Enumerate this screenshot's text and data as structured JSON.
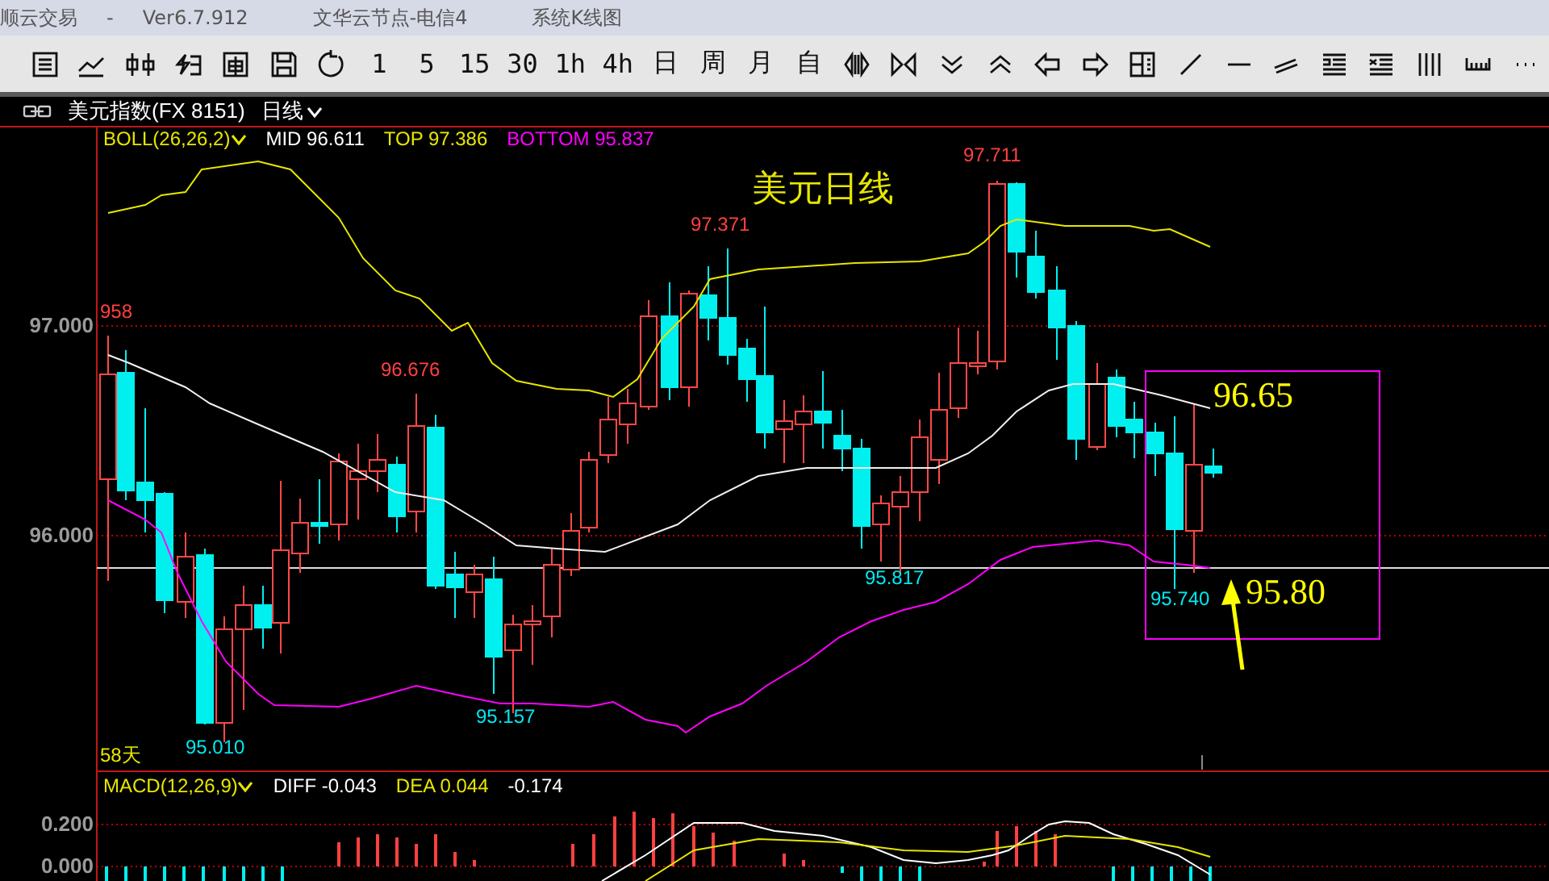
{
  "title_bar": {
    "app": "顺云交易",
    "separator": "-",
    "version": "Ver6.7.912",
    "server": "文华云节点-电信4",
    "window": "系统K线图"
  },
  "toolbar": {
    "periods": [
      {
        "label": "1"
      },
      {
        "label": "5"
      },
      {
        "label": "15"
      },
      {
        "label": "30"
      },
      {
        "label": "1h"
      },
      {
        "label": "4h"
      },
      {
        "label": "日"
      },
      {
        "label": "周"
      },
      {
        "label": "月"
      },
      {
        "label": "自"
      }
    ]
  },
  "chart": {
    "symbol": "美元指数(FX 8151)",
    "period": "日线",
    "indicator": {
      "name": "BOLL(26,26,2)",
      "mid": "MID 96.611",
      "top": "TOP 97.386",
      "bottom": "BOTTOM 95.837"
    },
    "title": "美元日线",
    "y_ticks": [
      "97.000",
      "96.000"
    ],
    "price_labels": [
      {
        "text": "958",
        "kind": "high"
      },
      {
        "text": "96.676",
        "kind": "high"
      },
      {
        "text": "97.371",
        "kind": "high"
      },
      {
        "text": "97.711",
        "kind": "high"
      },
      {
        "text": "95.010",
        "kind": "low"
      },
      {
        "text": "95.157",
        "kind": "low"
      },
      {
        "text": "95.817",
        "kind": "low"
      },
      {
        "text": "95.740",
        "kind": "low"
      }
    ],
    "annotations": [
      "96.65",
      "95.80"
    ],
    "bar_count": "58天"
  },
  "macd": {
    "name": "MACD(12,26,9)",
    "diff": "DIFF -0.043",
    "dea": "DEA 0.044",
    "value": "-0.174",
    "y_ticks": [
      "0.200",
      "0.000"
    ]
  }
}
